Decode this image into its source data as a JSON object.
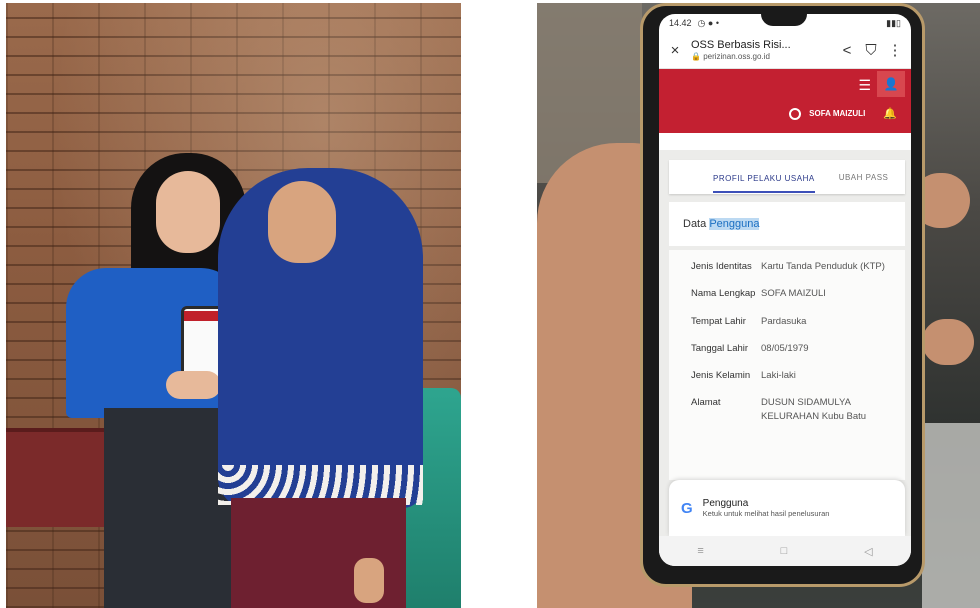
{
  "phone": {
    "status": {
      "time": "14.42"
    },
    "browser": {
      "close_icon": "×",
      "page_title": "OSS Berbasis Risi...",
      "domain": "perizinan.oss.go.id",
      "share_icon": "share",
      "bookmark_icon": "bookmark",
      "more_icon": "⋮"
    },
    "header": {
      "user_name": "SOFA MAIZULI"
    },
    "tabs": [
      {
        "label": "PROFIL PELAKU USAHA"
      },
      {
        "label": "UBAH PASS"
      }
    ],
    "section": {
      "title_prefix": "Data ",
      "title_highlight": "Pengguna"
    },
    "fields": [
      {
        "label": "Jenis Identitas",
        "value": "Kartu Tanda Penduduk (KTP)"
      },
      {
        "label": "Nama Lengkap",
        "value": "SOFA MAIZULI"
      },
      {
        "label": "Tempat Lahir",
        "value": "Pardasuka"
      },
      {
        "label": "Tanggal Lahir",
        "value": "08/05/1979"
      },
      {
        "label": "Jenis Kelamin",
        "value": "Laki-laki"
      },
      {
        "label": "Alamat",
        "value": "DUSUN SIDAMULYA KELURAHAN Kubu Batu"
      }
    ],
    "google_sheet": {
      "logo": "G",
      "title": "Pengguna",
      "subtitle": "Ketuk untuk melihat hasil penelusuran"
    },
    "navbar": [
      "≡",
      "□",
      "◁"
    ]
  }
}
